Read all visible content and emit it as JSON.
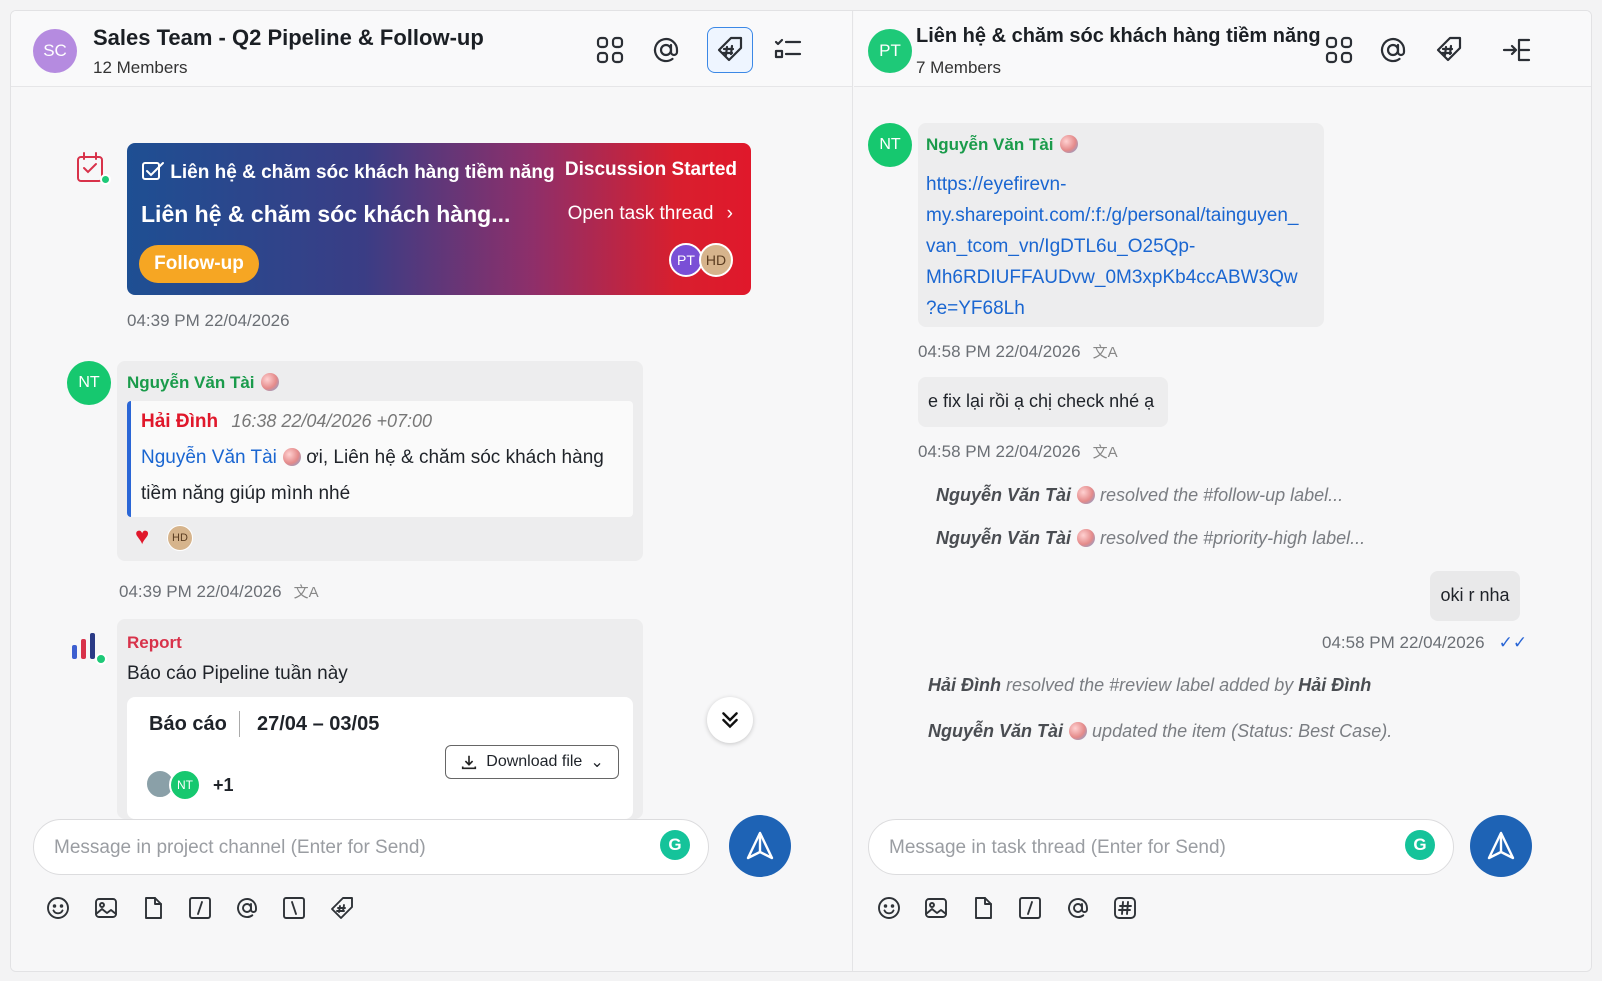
{
  "left": {
    "header": {
      "avatar": "SC",
      "title": "Sales Team - Q2 Pipeline & Follow-up",
      "members": "12 Members"
    },
    "task_card": {
      "label": "Liên hệ & chăm sóc khách hàng tiềm năng",
      "status": "Discussion Started",
      "title": "Liên hệ & chăm sóc khách hàng...",
      "open_link": "Open task thread",
      "tag": "Follow-up",
      "assignees": [
        "PT",
        "HD"
      ],
      "timestamp": "04:39 PM 22/04/2026"
    },
    "message1": {
      "avatar": "NT",
      "sender": "Nguyễn Văn Tài",
      "quote_author": "Hải Đình",
      "quote_time": "16:38 22/04/2026 +07:00",
      "mention": "Nguyễn Văn Tài",
      "text_part1": "ơi, Liên hệ & chăm sóc khách hàng",
      "text_part2": "tiềm năng giúp mình nhé",
      "reaction_avatar": "HD",
      "timestamp": "04:39 PM 22/04/2026",
      "translate_icon": "translate-icon"
    },
    "report": {
      "label": "Report",
      "description": "Báo cáo Pipeline tuần này",
      "card_title": "Báo cáo",
      "period": "27/04 – 03/05",
      "download": "Download file",
      "avatar": "NT",
      "extra": "+1"
    },
    "input_placeholder": "Message in project channel (Enter for Send)"
  },
  "right": {
    "header": {
      "avatar": "PT",
      "title": "Liên hệ & chăm sóc khách hàng tiềm năng",
      "members": "7 Members"
    },
    "message1": {
      "avatar": "NT",
      "sender": "Nguyễn Văn Tài",
      "link_lines": [
        "https://eyefirevn-",
        "my.sharepoint.com/:f:/g/personal/tainguyen_",
        "van_tcom_vn/IgDTL6u_O25Qp-",
        "Mh6RDIUFFAUDvw_0M3xpKb4ccABW3Qw",
        "?e=YF68Lh"
      ],
      "timestamp": "04:58 PM 22/04/2026"
    },
    "message2": {
      "text": "e fix lại rồi ạ chị check nhé ạ",
      "timestamp": "04:58 PM 22/04/2026"
    },
    "system1": {
      "actor": "Nguyễn Văn Tài",
      "text": "resolved the  #follow-up label..."
    },
    "system2": {
      "actor": "Nguyễn Văn Tài",
      "text": "resolved the  #priority-high label..."
    },
    "own_message": {
      "text": "oki r nha",
      "timestamp": "04:58 PM 22/04/2026"
    },
    "system3": {
      "actor": "Hải Đình",
      "text": "resolved the  #review label added by",
      "actor2": "Hải Đình"
    },
    "system4": {
      "actor": "Nguyễn Văn Tài",
      "text": "updated the item (Status: Best Case)."
    },
    "input_placeholder": "Message in task thread (Enter for Send)"
  },
  "colors": {
    "sc_avatar": "#b58be0",
    "pt_avatar": "#1ec978",
    "nt_avatar": "#16c86f",
    "send": "#1e63b5",
    "tag": "#f6a623",
    "red": "#e0182b"
  }
}
